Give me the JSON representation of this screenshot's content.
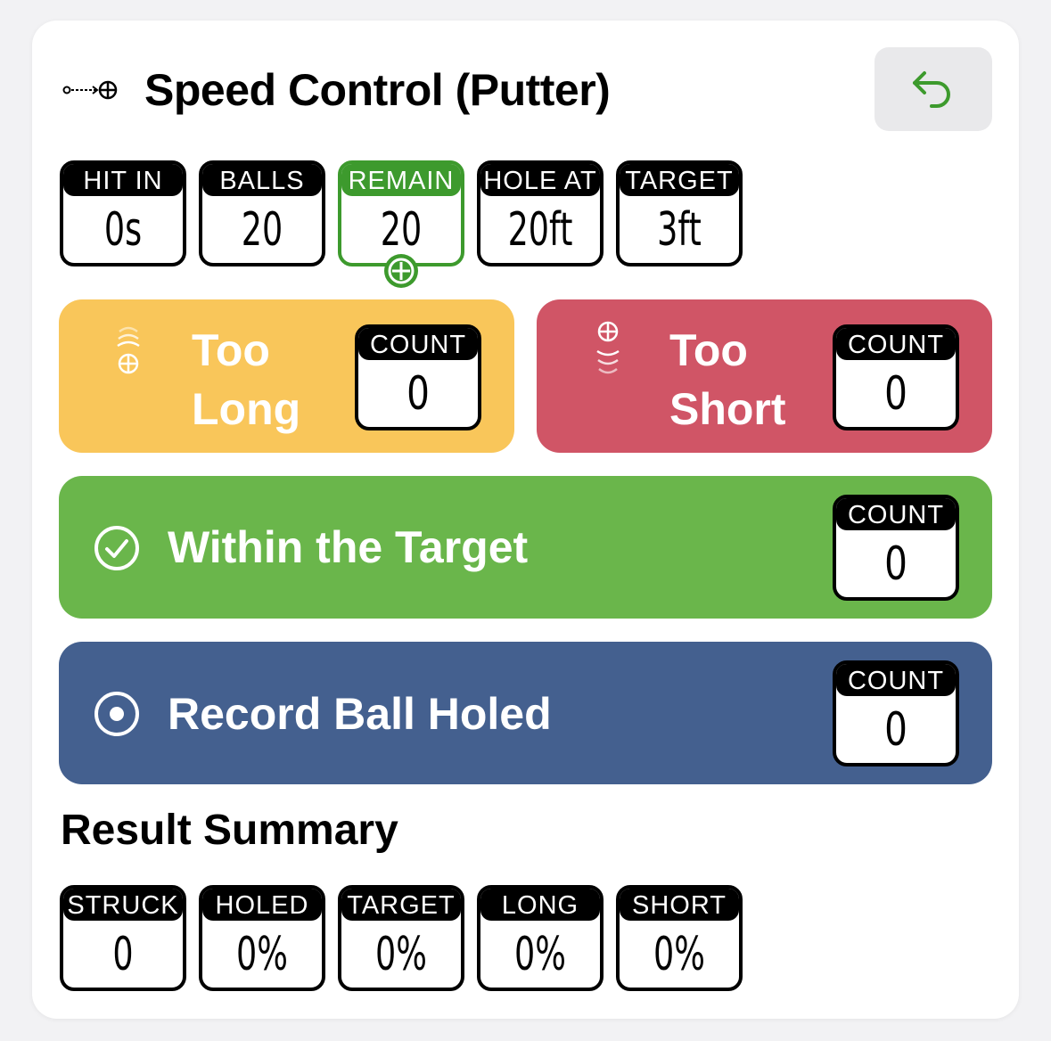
{
  "header": {
    "title": "Speed Control (Putter)",
    "icon": "putt-line-icon",
    "back_icon": "undo-arrow-icon",
    "accent": "#3d9a2d"
  },
  "stats": [
    {
      "label": "HIT IN",
      "value": "0s"
    },
    {
      "label": "BALLS",
      "value": "20"
    },
    {
      "label": "REMAIN",
      "value": "20",
      "highlight": true
    },
    {
      "label": "HOLE AT",
      "value": "20ft"
    },
    {
      "label": "TARGET",
      "value": "3ft"
    }
  ],
  "buttons": {
    "too_long": {
      "line1": "Too",
      "line2": "Long",
      "count_label": "COUNT",
      "count": "0",
      "color": "#f9c65a"
    },
    "too_short": {
      "line1": "Too",
      "line2": "Short",
      "count_label": "COUNT",
      "count": "0",
      "color": "#d05566"
    },
    "within_target": {
      "label": "Within the Target",
      "count_label": "COUNT",
      "count": "0",
      "color": "#6ab64b"
    },
    "ball_holed": {
      "label": "Record Ball Holed",
      "count_label": "COUNT",
      "count": "0",
      "color": "#44608f"
    }
  },
  "summary": {
    "title": "Result Summary",
    "items": [
      {
        "label": "STRUCK",
        "value": "0"
      },
      {
        "label": "HOLED",
        "value": "0%"
      },
      {
        "label": "TARGET",
        "value": "0%"
      },
      {
        "label": "LONG",
        "value": "0%"
      },
      {
        "label": "SHORT",
        "value": "0%"
      }
    ]
  }
}
